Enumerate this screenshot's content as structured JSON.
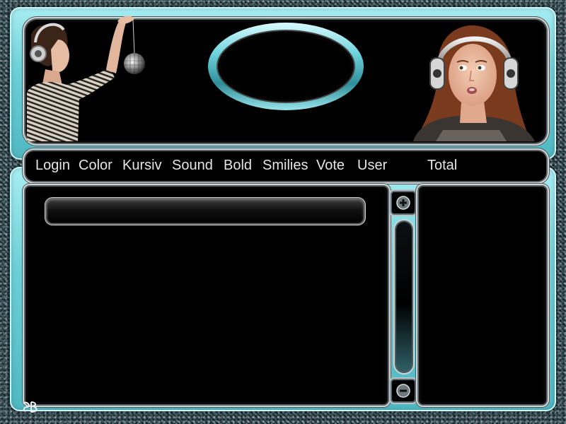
{
  "toolbar": {
    "items": [
      {
        "label": "Login"
      },
      {
        "label": "Color"
      },
      {
        "label": "Kursiv"
      },
      {
        "label": "Sound"
      },
      {
        "label": "Bold"
      },
      {
        "label": "Smilies"
      },
      {
        "label": "Vote"
      },
      {
        "label": "User"
      },
      {
        "label": "Total"
      }
    ]
  },
  "chat": {
    "input_value": "",
    "input_placeholder": ""
  },
  "scroll": {
    "up_icon": "plus-circle-icon",
    "down_icon": "minus-circle-icon"
  },
  "colors": {
    "panel_cyan": "#6fd0d8",
    "panel_highlight": "#a7eef3",
    "box_black": "#000000",
    "menu_text": "#e6e6e6"
  },
  "header": {
    "left_image": "woman-with-headphones-holding-disco-ball",
    "right_image": "girl-with-headphones"
  },
  "footer": {
    "signature": "SB"
  }
}
